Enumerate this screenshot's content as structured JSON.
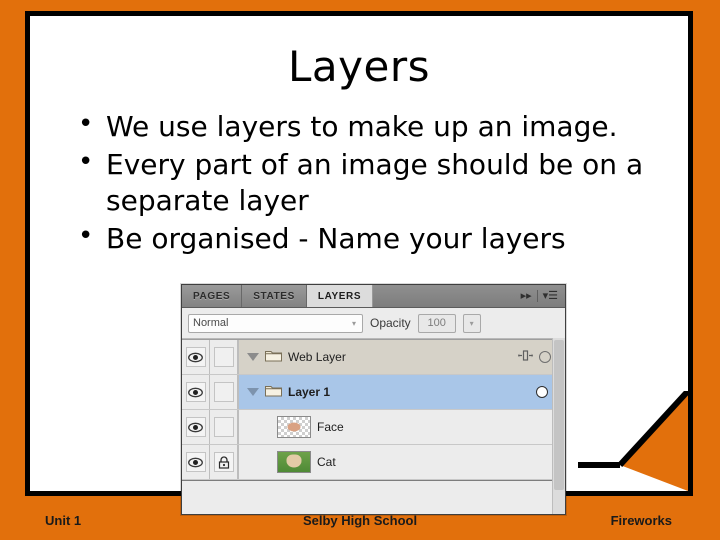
{
  "slide": {
    "title": "Layers",
    "bullets": [
      "We use layers to make up an image.",
      "Every part of an image should be on a separate layer",
      "Be organised  - Name your layers"
    ],
    "footer": {
      "left": "Unit 1",
      "center": "Selby High School",
      "right": "Fireworks"
    },
    "colors": {
      "background": "#e2700c",
      "card": "#ffffff",
      "border": "#000000",
      "fold": "#c9c9c9"
    }
  },
  "fireworks_panel": {
    "tabs": [
      {
        "label": "PAGES",
        "active": false
      },
      {
        "label": "STATES",
        "active": false
      },
      {
        "label": "LAYERS",
        "active": true
      }
    ],
    "tab_icons": [
      {
        "name": "collapse-panel-icon",
        "glyph": "▸▸"
      },
      {
        "name": "panel-menu-icon",
        "glyph": "▾☰"
      }
    ],
    "options": {
      "blend_mode": "Normal",
      "opacity_label": "Opacity",
      "opacity_value": "100",
      "caret": "▾"
    },
    "rows": [
      {
        "type": "group",
        "name": "Web Layer",
        "visible": true,
        "locked": false,
        "expanded": true,
        "selected": false,
        "bold": false,
        "share_icon": true,
        "radio": true
      },
      {
        "type": "group",
        "name": "Layer 1",
        "visible": true,
        "locked": false,
        "expanded": true,
        "selected": true,
        "bold": true,
        "share_icon": false,
        "radio": true
      },
      {
        "type": "object",
        "name": "Face",
        "visible": true,
        "locked": false,
        "thumb": "transparent-face-thumbnail",
        "selected": false
      },
      {
        "type": "object",
        "name": "Cat",
        "visible": true,
        "locked": true,
        "thumb": "cat-on-grass-thumbnail",
        "selected": false
      }
    ],
    "icons": {
      "eye": "eye-icon",
      "lock": "lock-icon",
      "folder": "folder-icon",
      "disclosure": "disclosure-triangle-icon",
      "share_across_states": "share-across-states-icon"
    },
    "colors": {
      "panel_bg": "#ececec",
      "tabbar": "#858585",
      "active_tab": "#dcdcdc",
      "group_row": "#d6d2c8",
      "selected_row": "#a9c6e8"
    }
  }
}
